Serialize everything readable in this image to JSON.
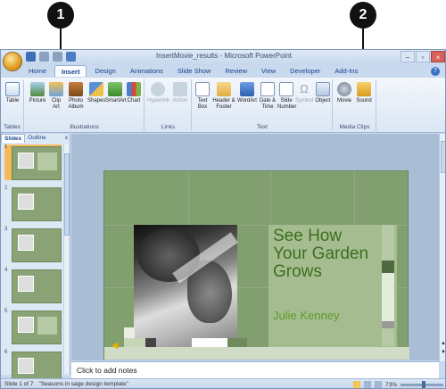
{
  "callouts": [
    "1",
    "2"
  ],
  "window": {
    "title": "InsertMovie_results - Microsoft PowerPoint"
  },
  "tabs": [
    "Home",
    "Insert",
    "Design",
    "Animations",
    "Slide Show",
    "Review",
    "View",
    "Developer",
    "Add-Ins"
  ],
  "active_tab": "Insert",
  "ribbon": {
    "groups": [
      {
        "label": "Tables",
        "commands": [
          {
            "label": "Table",
            "icon": "table-icon"
          }
        ]
      },
      {
        "label": "Illustrations",
        "commands": [
          {
            "label": "Picture",
            "icon": "picture-icon"
          },
          {
            "label": "Clip Art",
            "icon": "clipart-icon"
          },
          {
            "label": "Photo Album",
            "icon": "photo-album-icon"
          },
          {
            "label": "Shapes",
            "icon": "shapes-icon"
          },
          {
            "label": "SmartArt",
            "icon": "smartart-icon"
          },
          {
            "label": "Chart",
            "icon": "chart-icon"
          }
        ]
      },
      {
        "label": "Links",
        "commands": [
          {
            "label": "Hyperlink",
            "icon": "hyperlink-icon",
            "disabled": true
          },
          {
            "label": "Action",
            "icon": "action-icon",
            "disabled": true
          }
        ]
      },
      {
        "label": "Text",
        "commands": [
          {
            "label": "Text Box",
            "icon": "textbox-icon"
          },
          {
            "label": "Header & Footer",
            "icon": "header-footer-icon"
          },
          {
            "label": "WordArt",
            "icon": "wordart-icon"
          },
          {
            "label": "Date & Time",
            "icon": "date-time-icon"
          },
          {
            "label": "Slide Number",
            "icon": "slide-number-icon"
          },
          {
            "label": "Symbol",
            "icon": "symbol-icon",
            "disabled": true
          },
          {
            "label": "Object",
            "icon": "object-icon"
          }
        ]
      },
      {
        "label": "Media Clips",
        "commands": [
          {
            "label": "Movie",
            "icon": "movie-icon"
          },
          {
            "label": "Sound",
            "icon": "sound-icon"
          }
        ]
      }
    ]
  },
  "pane": {
    "tabs": [
      "Slides",
      "Outline"
    ],
    "close": "x",
    "slide_numbers": [
      "1",
      "2",
      "3",
      "4",
      "5",
      "6"
    ]
  },
  "slide": {
    "title": "See How Your Garden Grows",
    "subtitle": "Julie Kenney"
  },
  "notes": {
    "placeholder": "Click to add notes"
  },
  "status": {
    "slide_info": "Slide 1 of 7",
    "theme": "\"Seasons in sage design template\"",
    "zoom": "73%"
  },
  "colors": {
    "slide_bg": "#82a06f",
    "title_text": "#3c6f1e",
    "subtitle_text": "#5f9a2b",
    "selected_thumb": "#f7b85c"
  }
}
